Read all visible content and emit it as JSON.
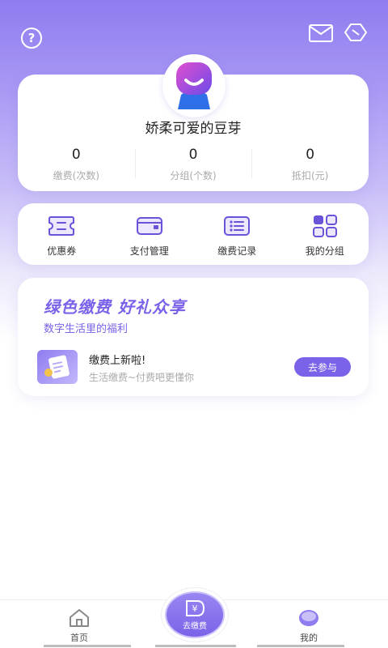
{
  "user": {
    "name": "娇柔可爱的豆芽"
  },
  "stats": [
    {
      "value": "0",
      "label": "缴费(次数)"
    },
    {
      "value": "0",
      "label": "分组(个数)"
    },
    {
      "value": "0",
      "label": "抵扣(元)"
    }
  ],
  "menu": [
    {
      "label": "优惠券",
      "icon": "coupon-icon"
    },
    {
      "label": "支付管理",
      "icon": "wallet-icon"
    },
    {
      "label": "缴费记录",
      "icon": "list-icon"
    },
    {
      "label": "我的分组",
      "icon": "grid-icon"
    }
  ],
  "promo": {
    "title": "绿色缴费  好礼众享",
    "subtitle": "数字生活里的福利",
    "heading": "缴费上新啦!",
    "desc": "生活缴费~付费吧更懂你",
    "button": "去参与"
  },
  "tabs": {
    "home": "首页",
    "pay": "去缴费",
    "pay_symbol": "¥",
    "mine": "我的"
  },
  "colors": {
    "accent": "#7b62e8",
    "header": "#8f7cf0"
  },
  "top_icons": {
    "help": "?"
  }
}
